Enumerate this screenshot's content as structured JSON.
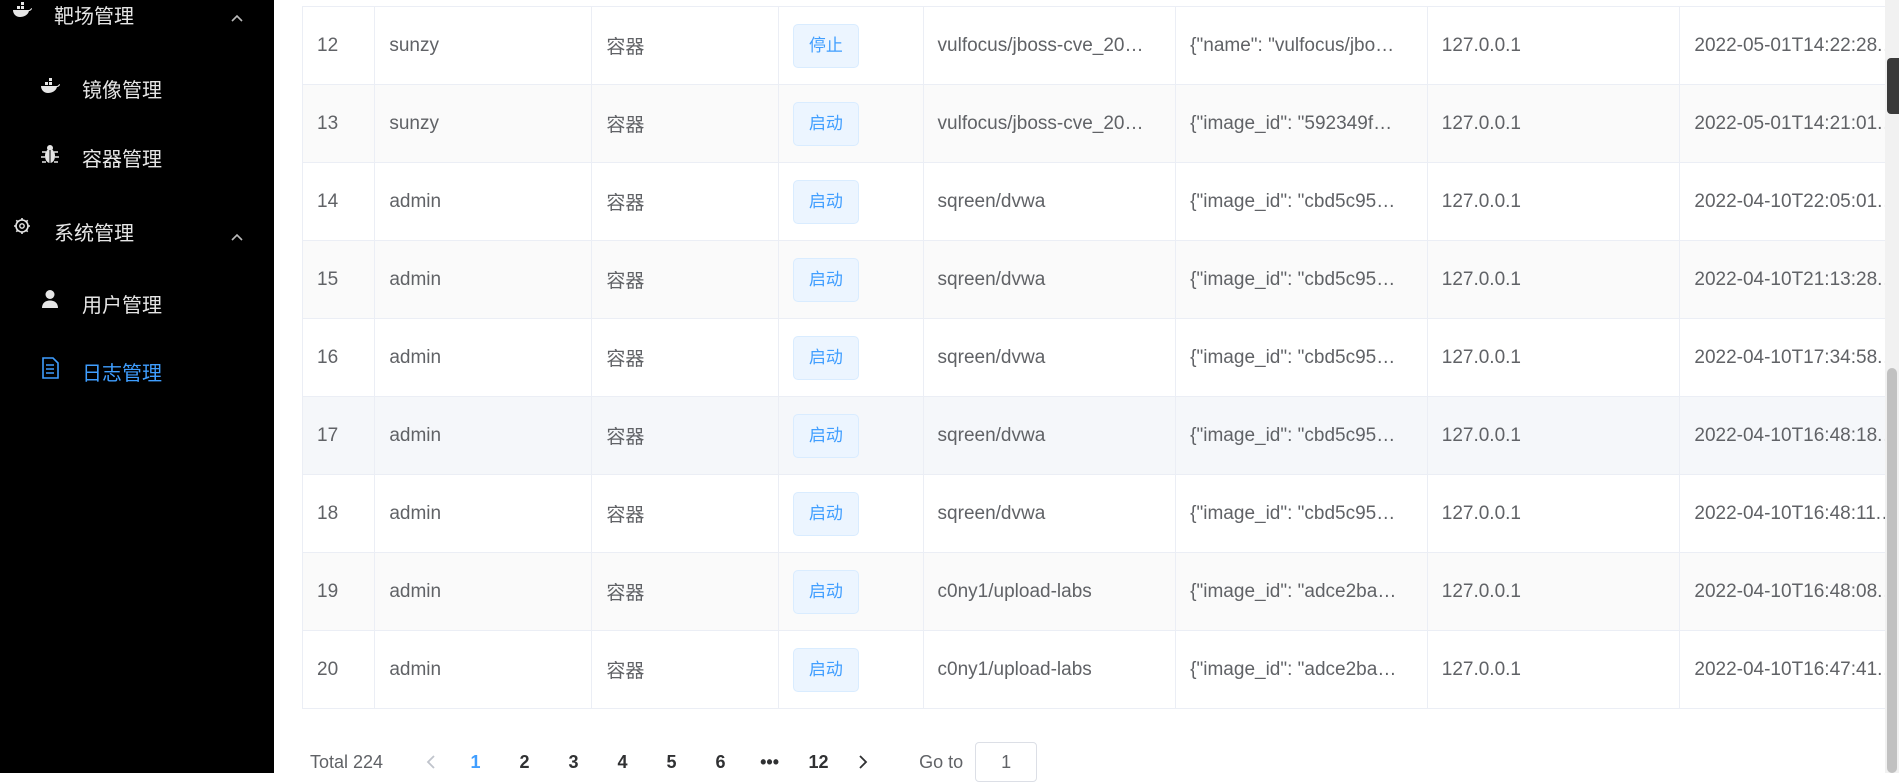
{
  "sidebar": {
    "items": [
      {
        "label": "靶场管理",
        "icon": "docker-icon",
        "expanded": true
      },
      {
        "label": "镜像管理",
        "icon": "docker-icon"
      },
      {
        "label": "容器管理",
        "icon": "bug-icon"
      },
      {
        "label": "系统管理",
        "icon": "gear-icon",
        "expanded": true
      },
      {
        "label": "用户管理",
        "icon": "user-icon"
      },
      {
        "label": "日志管理",
        "icon": "document-icon",
        "active": true
      }
    ],
    "active_color": "#3f9eff"
  },
  "table": {
    "rows": [
      {
        "id": "12",
        "user": "sunzy",
        "type": "容器",
        "action": "停止",
        "target": "vulfocus/jboss-cve_20…",
        "info": "{\"name\": \"vulfocus/jbo…",
        "ip": "127.0.0.1",
        "time": "2022-05-01T14:22:28.…"
      },
      {
        "id": "13",
        "user": "sunzy",
        "type": "容器",
        "action": "启动",
        "target": "vulfocus/jboss-cve_20…",
        "info": "{\"image_id\": \"592349f…",
        "ip": "127.0.0.1",
        "time": "2022-05-01T14:21:01.…"
      },
      {
        "id": "14",
        "user": "admin",
        "type": "容器",
        "action": "启动",
        "target": "sqreen/dvwa",
        "info": "{\"image_id\": \"cbd5c95…",
        "ip": "127.0.0.1",
        "time": "2022-04-10T22:05:01.…"
      },
      {
        "id": "15",
        "user": "admin",
        "type": "容器",
        "action": "启动",
        "target": "sqreen/dvwa",
        "info": "{\"image_id\": \"cbd5c95…",
        "ip": "127.0.0.1",
        "time": "2022-04-10T21:13:28.…"
      },
      {
        "id": "16",
        "user": "admin",
        "type": "容器",
        "action": "启动",
        "target": "sqreen/dvwa",
        "info": "{\"image_id\": \"cbd5c95…",
        "ip": "127.0.0.1",
        "time": "2022-04-10T17:34:58.…"
      },
      {
        "id": "17",
        "user": "admin",
        "type": "容器",
        "action": "启动",
        "target": "sqreen/dvwa",
        "info": "{\"image_id\": \"cbd5c95…",
        "ip": "127.0.0.1",
        "time": "2022-04-10T16:48:18.…"
      },
      {
        "id": "18",
        "user": "admin",
        "type": "容器",
        "action": "启动",
        "target": "sqreen/dvwa",
        "info": "{\"image_id\": \"cbd5c95…",
        "ip": "127.0.0.1",
        "time": "2022-04-10T16:48:11.…"
      },
      {
        "id": "19",
        "user": "admin",
        "type": "容器",
        "action": "启动",
        "target": "c0ny1/upload-labs",
        "info": "{\"image_id\": \"adce2ba…",
        "ip": "127.0.0.1",
        "time": "2022-04-10T16:48:08.…"
      },
      {
        "id": "20",
        "user": "admin",
        "type": "容器",
        "action": "启动",
        "target": "c0ny1/upload-labs",
        "info": "{\"image_id\": \"adce2ba…",
        "ip": "127.0.0.1",
        "time": "2022-04-10T16:47:41.…"
      }
    ]
  },
  "pagination": {
    "total": "Total 224",
    "pages": [
      "1",
      "2",
      "3",
      "4",
      "5",
      "6",
      "•••",
      "12"
    ],
    "current": "1",
    "goto_label": "Go to",
    "goto_value": "1"
  }
}
